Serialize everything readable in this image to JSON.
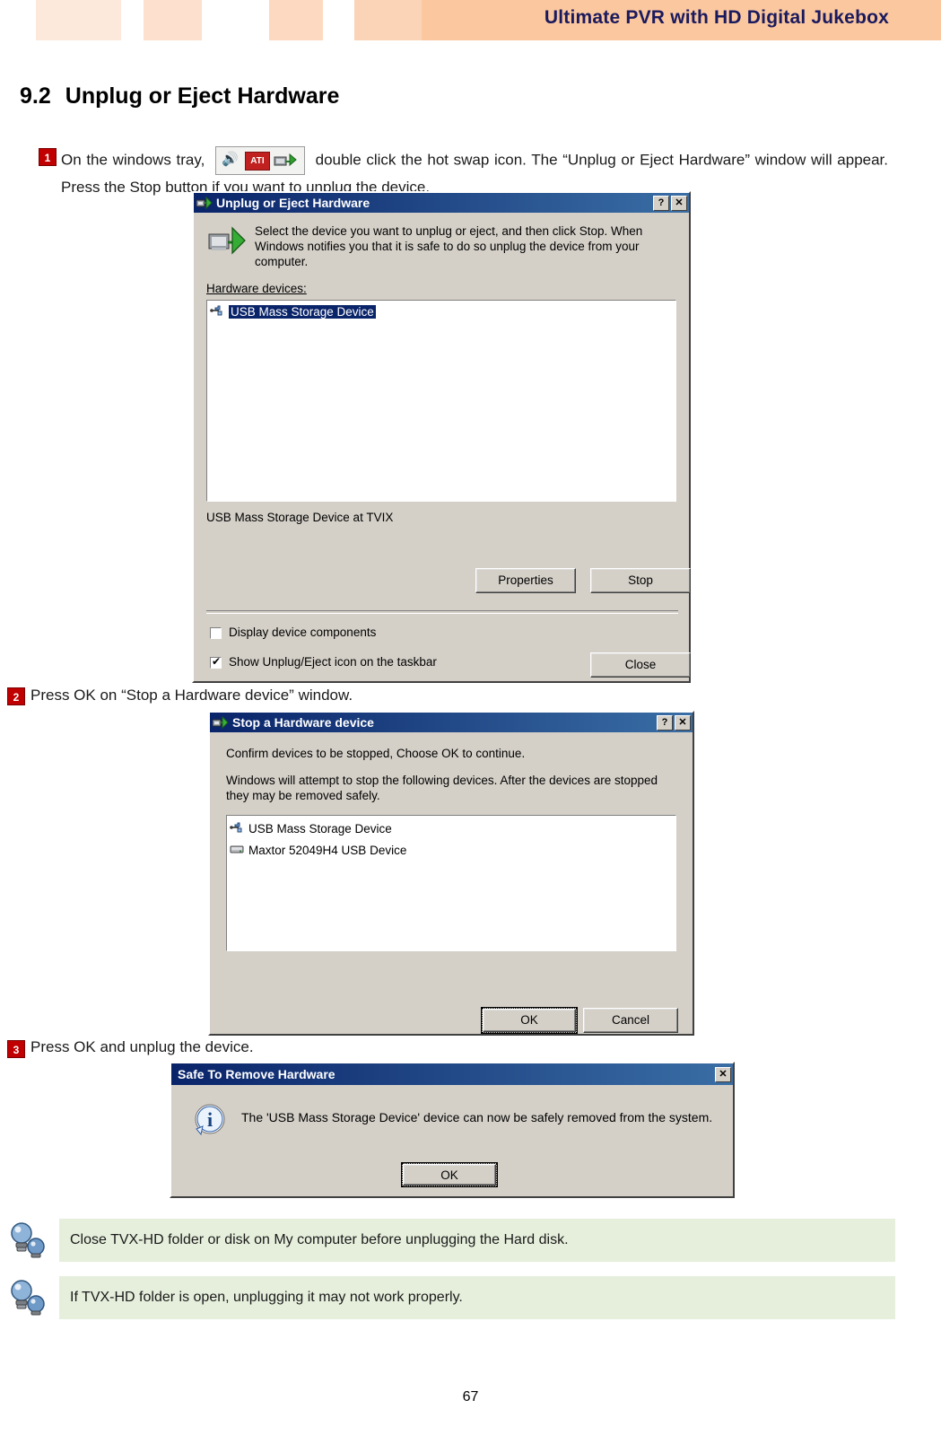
{
  "banner": {
    "title": "Ultimate PVR with HD Digital Jukebox"
  },
  "section": {
    "number": "9.2",
    "title": "Unplug or Eject Hardware"
  },
  "steps": [
    {
      "badge": "1",
      "text_before": "On the windows tray,",
      "icon_name": "hot-swap-tray-icons",
      "text_after": "double click the hot swap icon. The “Unplug or Eject Hardware” window will appear. Press the Stop button if you want to unplug the device."
    },
    {
      "badge": "2",
      "text": "Press OK on “Stop a Hardware device” window."
    },
    {
      "badge": "3",
      "text": "Press OK and unplug the device."
    }
  ],
  "dialog1": {
    "title": "Unplug or Eject Hardware",
    "titlebar_buttons": [
      "?",
      "✕"
    ],
    "instruction": "Select the device you want to unplug or eject, and then click Stop. When Windows notifies you that it is safe to do so unplug the device from your computer.",
    "list_label": "Hardware devices:",
    "list_items": [
      "USB Mass Storage Device"
    ],
    "status_text": "USB Mass Storage Device at TVIX",
    "buttons": {
      "properties": "Properties",
      "stop": "Stop",
      "close": "Close"
    },
    "checkboxes": [
      {
        "label": "Display device components",
        "checked": false
      },
      {
        "label": "Show Unplug/Eject icon on the taskbar",
        "checked": true
      }
    ]
  },
  "dialog2": {
    "title": "Stop a Hardware device",
    "titlebar_buttons": [
      "?",
      "✕"
    ],
    "line1": "Confirm devices to be stopped, Choose OK to continue.",
    "line2": "Windows will attempt to stop the following devices. After the devices are stopped they may be removed safely.",
    "list_items": [
      "USB Mass Storage Device",
      "Maxtor 52049H4 USB Device"
    ],
    "buttons": {
      "ok": "OK",
      "cancel": "Cancel"
    }
  },
  "dialog3": {
    "title": "Safe To Remove Hardware",
    "titlebar_buttons": [
      "✕"
    ],
    "message": "The 'USB Mass Storage Device' device can now be safely removed from the system.",
    "buttons": {
      "ok": "OK"
    }
  },
  "notes": [
    "Close TVX-HD folder or disk on My computer before unplugging the Hard disk.",
    "If TVX-HD folder is open, unplugging it may not work properly."
  ],
  "page_number": "67"
}
